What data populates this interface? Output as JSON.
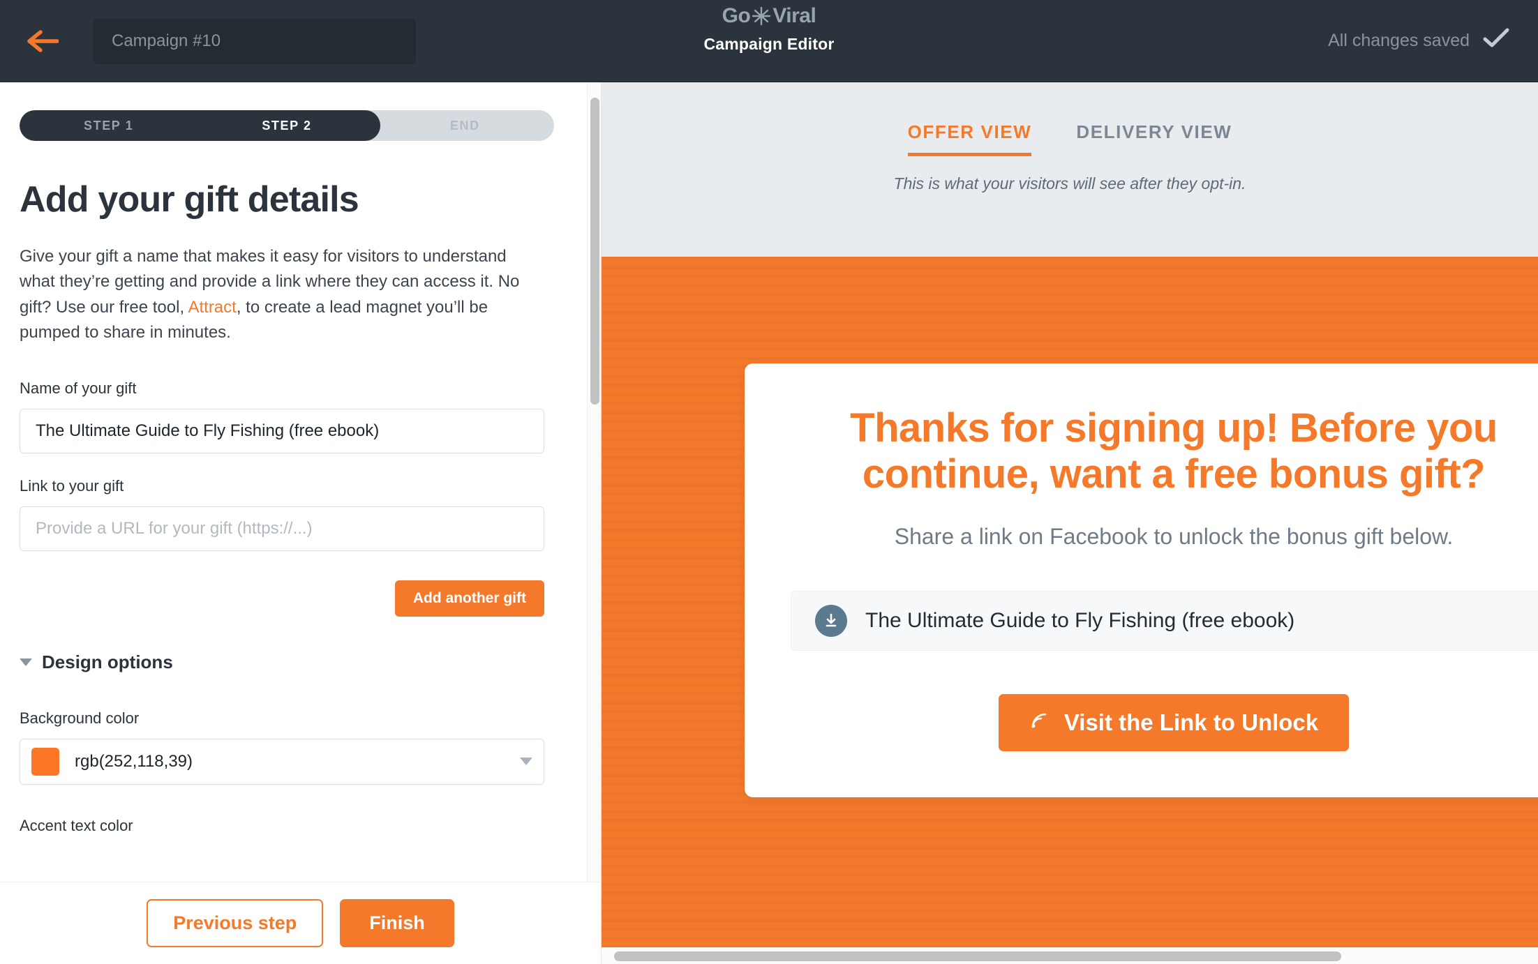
{
  "topbar": {
    "back_icon": "back-arrow-icon",
    "campaign_name_value": "Campaign #10",
    "campaign_name_placeholder": "Campaign #10",
    "brand_left": "Go",
    "brand_right": "Viral",
    "brand_star_icon": "starburst-icon",
    "subtitle": "Campaign Editor",
    "save_status": "All changes saved",
    "save_icon": "checkmark-icon",
    "bg_color": "#2b333c"
  },
  "steps": {
    "items": [
      {
        "label": "STEP 1",
        "state": "done"
      },
      {
        "label": "STEP 2",
        "state": "active"
      },
      {
        "label": "END",
        "state": "pending"
      }
    ],
    "progress_percent": 67.5
  },
  "editor": {
    "title": "Add your gift details",
    "intro_part1": "Give your gift a name that makes it easy for visitors to understand what they’re getting and provide a link where they can access it. No gift? Use our free tool, ",
    "intro_link": "Attract",
    "intro_part2": ", to create a lead magnet you’ll be pumped to share in minutes.",
    "gift_name_label": "Name of your gift",
    "gift_name_value": "The Ultimate Guide to Fly Fishing (free ebook)",
    "gift_name_placeholder": "Name of your gift",
    "gift_link_label": "Link to your gift",
    "gift_link_value": "",
    "gift_link_placeholder": "Provide a URL for your gift (https://...)",
    "add_another_gift": "Add another gift",
    "design_options_label": "Design options",
    "design_options_expanded": true,
    "background_color_label": "Background color",
    "background_color_value": "rgb(252,118,39)",
    "background_color_hex": "#fc7627",
    "accent_text_color_label": "Accent text color",
    "previous_step": "Previous step",
    "finish": "Finish"
  },
  "preview": {
    "tabs": [
      {
        "label": "OFFER VIEW",
        "active": true
      },
      {
        "label": "DELIVERY VIEW",
        "active": false
      }
    ],
    "hint": "This is what your visitors will see after they opt-in.",
    "stage_bg_color": "#f4792b",
    "headline": "Thanks for signing up! Before you continue, want a free bonus gift?",
    "subtext": "Share a link on Facebook to unlock the bonus gift below.",
    "gift_icon": "download-icon",
    "gift_title": "The Ultimate Guide to Fly Fishing (free ebook)",
    "cta_icon": "share-rss-icon",
    "cta_label": "Visit the Link to Unlock"
  },
  "colors": {
    "accent": "#f4792b",
    "dark": "#2b333c",
    "panel": "#e8ecef"
  }
}
